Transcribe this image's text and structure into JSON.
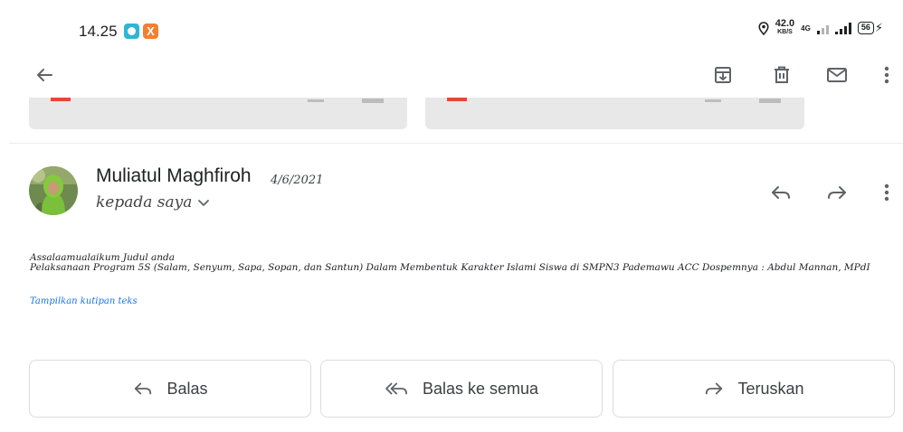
{
  "status_bar": {
    "time": "14.25",
    "notif_2_letter": "X",
    "net_speed_value": "42.0",
    "net_speed_unit": "KB/S",
    "network_type": "4G",
    "battery": "56"
  },
  "message": {
    "sender": "Muliatul Maghfiroh",
    "date": "4/6/2021",
    "recipient": "kepada saya",
    "body_line_1": "Assalaamualaikum Judul anda",
    "body_line_2": "Pelaksanaan Program 5S (Salam, Senyum, Sapa, Sopan, dan Santun) Dalam Membentuk Karakter Islami Siswa di SMPN3 Pademawu ACC Dospemnya : Abdul Mannan, MPdI",
    "show_quoted_text": "Tampilkan kutipan teks"
  },
  "actions": {
    "reply": "Balas",
    "reply_all": "Balas ke semua",
    "forward": "Teruskan"
  },
  "colors": {
    "accent": "#1a73e8",
    "icon": "#5f6368",
    "attachment_bg": "#e8e8e8",
    "pdf_red": "#e8453c"
  },
  "icons": [
    "back-arrow-icon",
    "archive-icon",
    "trash-icon",
    "mail-icon",
    "more-vert-icon",
    "reply-icon",
    "reply-all-icon",
    "forward-icon",
    "chevron-down-icon",
    "location-icon"
  ]
}
